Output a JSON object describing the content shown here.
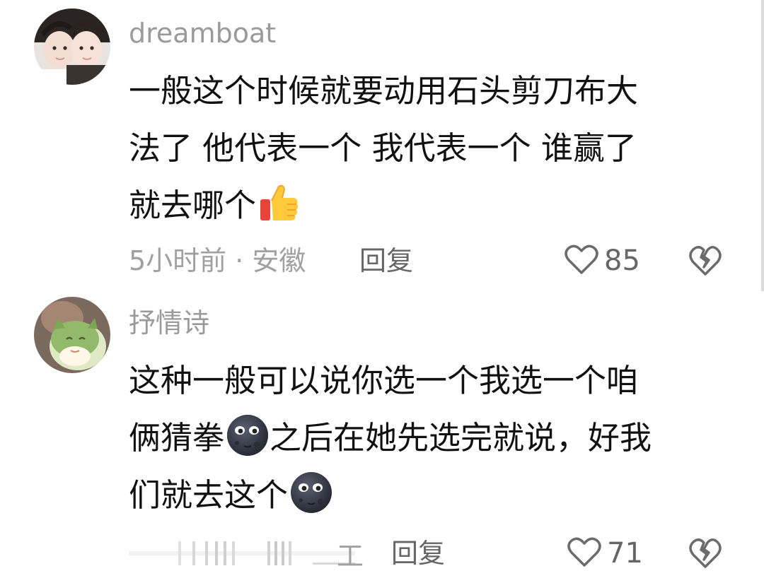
{
  "comments": [
    {
      "username": "dreamboat",
      "lines": [
        "一般这个时候就要动用石头剪刀布大",
        "法了 他代表一个 我代表一个 谁赢了",
        "就去哪个"
      ],
      "emoji": "thumbs-up-icon",
      "meta": "5小时前 · 安徽",
      "reply_label": "回复",
      "likes": "85"
    },
    {
      "username": "抒情诗",
      "lines": [
        "这种一般可以说你选一个我选一个咱",
        "俩猜拳",
        "之后在她先选完就说，好我",
        "们就去这个"
      ],
      "emoji": "moon-face-icon",
      "meta_visible": "工",
      "reply_label": "回复",
      "likes": "71"
    }
  ],
  "colors": {
    "text": "#111111",
    "meta": "#a0a0a0",
    "username": "#9a9a9a",
    "icon": "#6b6b6b"
  }
}
